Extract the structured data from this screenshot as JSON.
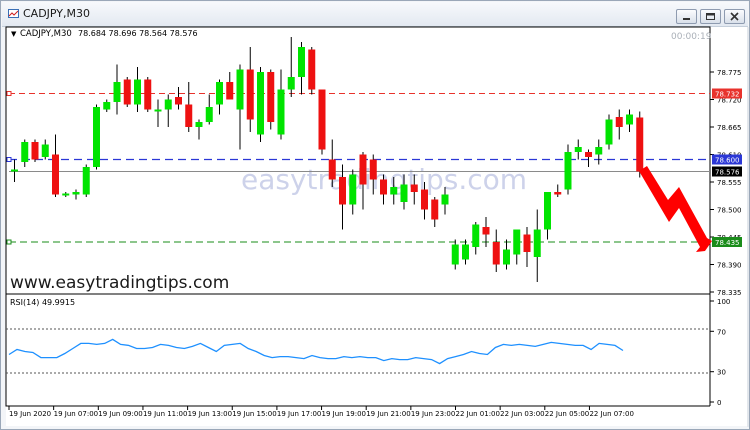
{
  "window": {
    "title": "CADJPY,M30"
  },
  "chart": {
    "info_symbol": "CADJPY,M30",
    "info_ohlc": "78.684 78.696 78.564 78.576",
    "timer": "00:00:19",
    "watermark_center": "easytradingtips.com",
    "watermark_footer": "www.easytradingtips.com",
    "price_scale": [
      "78.775",
      "78.720",
      "78.665",
      "78.610",
      "78.555",
      "78.500",
      "78.445",
      "78.390",
      "78.335"
    ],
    "price_tags": [
      {
        "text": "78.732",
        "bg": "#e8322c",
        "fg": "#ffffff",
        "style": "red-dashed-level"
      },
      {
        "text": "78.600",
        "bg": "#2b37d6",
        "fg": "#ffffff",
        "style": "blue-dashed-level"
      },
      {
        "text": "78.576",
        "bg": "#000000",
        "fg": "#ffffff",
        "style": "bid-line"
      },
      {
        "text": "78.435",
        "bg": "#1a8c1a",
        "fg": "#ffffff",
        "style": "green-dashed-level"
      }
    ],
    "time_labels": [
      "19 Jun 2020",
      "19 Jun 07:00",
      "19 Jun 09:00",
      "19 Jun 11:00",
      "19 Jun 13:00",
      "19 Jun 15:00",
      "19 Jun 17:00",
      "19 Jun 19:00",
      "19 Jun 21:00",
      "19 Jun 23:00",
      "22 Jun 01:00",
      "22 Jun 03:00",
      "22 Jun 05:00",
      "22 Jun 07:00"
    ],
    "colors": {
      "bull": "#00e400",
      "bear": "#ee1111",
      "wick": "#000000",
      "red_level": "#e8322c",
      "blue_level": "#2b37d6",
      "green_level": "#1a8c1a",
      "rsi": "#1e90ff",
      "arrow": "#ff0000"
    },
    "candles": [
      {
        "o": 78.58,
        "h": 78.6,
        "l": 78.555,
        "c": 78.58
      },
      {
        "o": 78.595,
        "h": 78.64,
        "l": 78.585,
        "c": 78.635
      },
      {
        "o": 78.635,
        "h": 78.64,
        "l": 78.595,
        "c": 78.6
      },
      {
        "o": 78.605,
        "h": 78.64,
        "l": 78.6,
        "c": 78.63
      },
      {
        "o": 78.61,
        "h": 78.65,
        "l": 78.525,
        "c": 78.53
      },
      {
        "o": 78.532,
        "h": 78.535,
        "l": 78.525,
        "c": 78.532
      },
      {
        "o": 78.53,
        "h": 78.54,
        "l": 78.52,
        "c": 78.535
      },
      {
        "o": 78.53,
        "h": 78.59,
        "l": 78.525,
        "c": 78.585
      },
      {
        "o": 78.585,
        "h": 78.71,
        "l": 78.58,
        "c": 78.705
      },
      {
        "o": 78.7,
        "h": 78.72,
        "l": 78.695,
        "c": 78.715
      },
      {
        "o": 78.715,
        "h": 78.79,
        "l": 78.69,
        "c": 78.755
      },
      {
        "o": 78.76,
        "h": 78.765,
        "l": 78.705,
        "c": 78.71
      },
      {
        "o": 78.71,
        "h": 78.785,
        "l": 78.695,
        "c": 78.76
      },
      {
        "o": 78.76,
        "h": 78.765,
        "l": 78.695,
        "c": 78.7
      },
      {
        "o": 78.7,
        "h": 78.72,
        "l": 78.665,
        "c": 78.7
      },
      {
        "o": 78.7,
        "h": 78.73,
        "l": 78.665,
        "c": 78.72
      },
      {
        "o": 78.725,
        "h": 78.745,
        "l": 78.7,
        "c": 78.71
      },
      {
        "o": 78.71,
        "h": 78.755,
        "l": 78.655,
        "c": 78.665
      },
      {
        "o": 78.665,
        "h": 78.68,
        "l": 78.64,
        "c": 78.675
      },
      {
        "o": 78.675,
        "h": 78.73,
        "l": 78.67,
        "c": 78.705
      },
      {
        "o": 78.71,
        "h": 78.76,
        "l": 78.69,
        "c": 78.755
      },
      {
        "o": 78.755,
        "h": 78.775,
        "l": 78.72,
        "c": 78.72
      },
      {
        "o": 78.7,
        "h": 78.79,
        "l": 78.62,
        "c": 78.78
      },
      {
        "o": 78.78,
        "h": 78.825,
        "l": 78.655,
        "c": 78.68
      },
      {
        "o": 78.65,
        "h": 78.785,
        "l": 78.635,
        "c": 78.775
      },
      {
        "o": 78.775,
        "h": 78.78,
        "l": 78.66,
        "c": 78.675
      },
      {
        "o": 78.65,
        "h": 78.78,
        "l": 78.64,
        "c": 78.74
      },
      {
        "o": 78.74,
        "h": 78.845,
        "l": 78.725,
        "c": 78.765
      },
      {
        "o": 78.765,
        "h": 78.835,
        "l": 78.73,
        "c": 78.825
      },
      {
        "o": 78.82,
        "h": 78.825,
        "l": 78.73,
        "c": 78.74
      },
      {
        "o": 78.74,
        "h": 78.725,
        "l": 78.61,
        "c": 78.62
      },
      {
        "o": 78.6,
        "h": 78.64,
        "l": 78.545,
        "c": 78.56
      },
      {
        "o": 78.565,
        "h": 78.59,
        "l": 78.46,
        "c": 78.51
      },
      {
        "o": 78.51,
        "h": 78.58,
        "l": 78.49,
        "c": 78.57
      },
      {
        "o": 78.61,
        "h": 78.615,
        "l": 78.5,
        "c": 78.55
      },
      {
        "o": 78.6,
        "h": 78.61,
        "l": 78.53,
        "c": 78.56
      },
      {
        "o": 78.56,
        "h": 78.57,
        "l": 78.51,
        "c": 78.53
      },
      {
        "o": 78.53,
        "h": 78.565,
        "l": 78.51,
        "c": 78.545
      },
      {
        "o": 78.515,
        "h": 78.57,
        "l": 78.5,
        "c": 78.55
      },
      {
        "o": 78.55,
        "h": 78.57,
        "l": 78.51,
        "c": 78.535
      },
      {
        "o": 78.54,
        "h": 78.555,
        "l": 78.48,
        "c": 78.5
      },
      {
        "o": 78.52,
        "h": 78.525,
        "l": 78.465,
        "c": 78.48
      },
      {
        "o": 78.51,
        "h": 78.545,
        "l": 78.49,
        "c": 78.53
      },
      {
        "o": 78.39,
        "h": 78.44,
        "l": 78.38,
        "c": 78.43
      },
      {
        "o": 78.4,
        "h": 78.44,
        "l": 78.39,
        "c": 78.43
      },
      {
        "o": 78.425,
        "h": 78.475,
        "l": 78.41,
        "c": 78.47
      },
      {
        "o": 78.465,
        "h": 78.485,
        "l": 78.425,
        "c": 78.45
      },
      {
        "o": 78.435,
        "h": 78.46,
        "l": 78.375,
        "c": 78.39
      },
      {
        "o": 78.39,
        "h": 78.44,
        "l": 78.38,
        "c": 78.42
      },
      {
        "o": 78.41,
        "h": 78.455,
        "l": 78.39,
        "c": 78.46
      },
      {
        "o": 78.45,
        "h": 78.465,
        "l": 78.385,
        "c": 78.415
      },
      {
        "o": 78.405,
        "h": 78.5,
        "l": 78.355,
        "c": 78.46
      },
      {
        "o": 78.46,
        "h": 78.535,
        "l": 78.44,
        "c": 78.535
      },
      {
        "o": 78.535,
        "h": 78.55,
        "l": 78.525,
        "c": 78.53
      },
      {
        "o": 78.54,
        "h": 78.63,
        "l": 78.53,
        "c": 78.615
      },
      {
        "o": 78.615,
        "h": 78.64,
        "l": 78.6,
        "c": 78.625
      },
      {
        "o": 78.615,
        "h": 78.62,
        "l": 78.585,
        "c": 78.605
      },
      {
        "o": 78.61,
        "h": 78.64,
        "l": 78.59,
        "c": 78.625
      },
      {
        "o": 78.63,
        "h": 78.69,
        "l": 78.62,
        "c": 78.68
      },
      {
        "o": 78.685,
        "h": 78.7,
        "l": 78.64,
        "c": 78.665
      },
      {
        "o": 78.67,
        "h": 78.7,
        "l": 78.655,
        "c": 78.69
      },
      {
        "o": 78.684,
        "h": 78.696,
        "l": 78.564,
        "c": 78.576
      }
    ],
    "rsi_label": "RSI(14) 49.9915",
    "rsi_scale": [
      "100",
      "70",
      "30",
      "0"
    ],
    "rsi_values": [
      47,
      52,
      50,
      49,
      44,
      44,
      44,
      48,
      53,
      58,
      58,
      57,
      58,
      62,
      57,
      56,
      53,
      53,
      54,
      57,
      56,
      54,
      53,
      55,
      58,
      54,
      50,
      56,
      57,
      58,
      53,
      50,
      46,
      44,
      45,
      45,
      44,
      43,
      46,
      44,
      43,
      43,
      45,
      44,
      45,
      44,
      44,
      41,
      43,
      42,
      42,
      44,
      43,
      42,
      38,
      43,
      45,
      47,
      50,
      48,
      47,
      54,
      57,
      56,
      57,
      56,
      55,
      57,
      59,
      58,
      57,
      56,
      56,
      52,
      58,
      57,
      56,
      51
    ]
  }
}
